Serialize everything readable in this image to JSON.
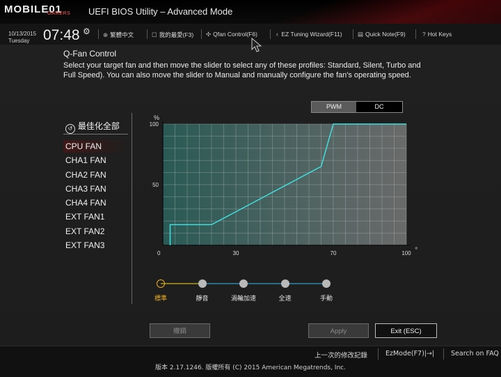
{
  "header": {
    "logo": "MOBILE01",
    "logo_sub": "GAMERS",
    "title": "UEFI BIOS Utility – Advanced Mode"
  },
  "infobar": {
    "date": "10/13/2015",
    "day": "Tuesday",
    "time": "07:48",
    "menu": [
      {
        "icon": "globe-icon",
        "label": "繁體中文"
      },
      {
        "icon": "star-icon",
        "label": "我的最愛(F3)"
      },
      {
        "icon": "fan-icon",
        "label": "Qfan Control(F6)"
      },
      {
        "icon": "bulb-icon",
        "label": "EZ Tuning Wizard(F11)"
      },
      {
        "icon": "note-icon",
        "label": "Quick Note(F9)"
      },
      {
        "icon": "help-icon",
        "label": "Hot Keys"
      }
    ]
  },
  "main": {
    "title": "Q-Fan Control",
    "description": "Select your target fan and then move the slider to select any of these profiles: Standard, Silent, Turbo and Full Speed). You can also move the slider to Manual and manually configure the fan's operating speed."
  },
  "fans": {
    "optimize_all": "最佳化全部",
    "list": [
      "CPU FAN",
      "CHA1 FAN",
      "CHA2 FAN",
      "CHA3 FAN",
      "CHA4 FAN",
      "EXT FAN1",
      "EXT FAN2",
      "EXT FAN3"
    ],
    "selected": "CPU FAN"
  },
  "mode_toggle": {
    "options": [
      "PWM",
      "DC"
    ],
    "selected": "PWM"
  },
  "chart_data": {
    "type": "line",
    "xlabel": "℃",
    "ylabel": "%",
    "xlim": [
      0,
      100
    ],
    "ylim": [
      0,
      100
    ],
    "x_ticks": [
      "0",
      "30",
      "70",
      "100"
    ],
    "y_ticks": [
      "50",
      "100"
    ],
    "grid": true,
    "series": [
      {
        "x": [
          3,
          3,
          20,
          65,
          70,
          100
        ],
        "y": [
          0,
          17,
          17,
          65,
          100,
          100
        ]
      }
    ]
  },
  "profiles": {
    "items": [
      "標準",
      "靜音",
      "渦輪加速",
      "全速",
      "手動"
    ],
    "selected": "標準"
  },
  "buttons": {
    "undo": "撤銷",
    "apply": "Apply",
    "exit": "Exit (ESC)"
  },
  "footer": {
    "last_modified": "上一次的修改記錄",
    "ezmode": "EzMode(F7)|→|",
    "search": "Search on FAQ",
    "version": "版本 2.17.1246. 版權所有 (C) 2015 American Megatrends, Inc."
  },
  "colors": {
    "curve": "#3fe0e0",
    "chart_fill": "#2a5a55",
    "profile_active": "#f0b020",
    "track_blue": "#2a6a8a",
    "track_yellow": "#8a7a20"
  }
}
